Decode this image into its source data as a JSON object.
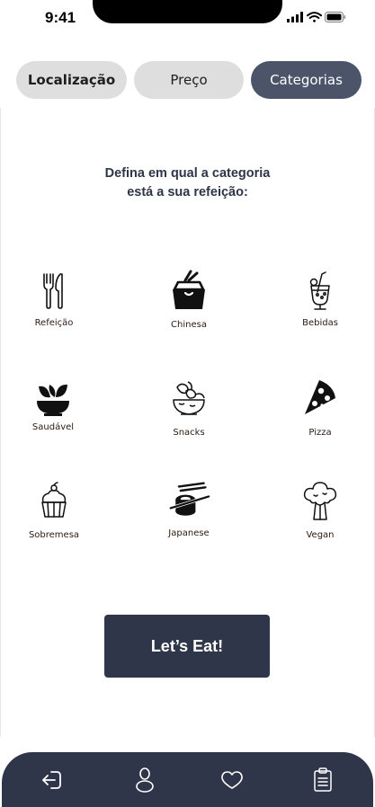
{
  "status_bar": {
    "time": "9:41"
  },
  "filters": [
    {
      "label": "Localização",
      "active": false
    },
    {
      "label": "Preço",
      "active": false
    },
    {
      "label": "Categorias",
      "active": true
    }
  ],
  "prompt": {
    "line1": "Defina em qual a categoria",
    "line2": "está a sua refeição:"
  },
  "categories": [
    {
      "label": "Refeição",
      "icon": "fork-knife-icon"
    },
    {
      "label": "Chinesa",
      "icon": "takeout-box-icon"
    },
    {
      "label": "Bebidas",
      "icon": "drink-glass-icon"
    },
    {
      "label": "Saudável",
      "icon": "salad-bowl-icon"
    },
    {
      "label": "Snacks",
      "icon": "snack-bowl-icon"
    },
    {
      "label": "Pizza",
      "icon": "pizza-slice-icon"
    },
    {
      "label": "Sobremesa",
      "icon": "cupcake-icon"
    },
    {
      "label": "Japanese",
      "icon": "sushi-chopsticks-icon"
    },
    {
      "label": "Vegan",
      "icon": "broccoli-icon"
    }
  ],
  "cta": {
    "label": "Let’s Eat!"
  },
  "bottom_nav": [
    {
      "icon": "logout-icon"
    },
    {
      "icon": "profile-icon"
    },
    {
      "icon": "heart-icon"
    },
    {
      "icon": "clipboard-icon"
    }
  ],
  "colors": {
    "accent_dark": "#2f3649",
    "pill_active": "#4b5468",
    "pill_inactive": "#dedede"
  }
}
